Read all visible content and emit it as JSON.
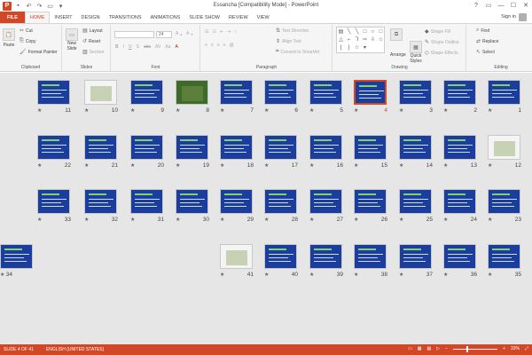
{
  "titlebar": {
    "app_icon": "P",
    "title": "Essancha [Compatibility Mode] - PowerPoint",
    "qat_icons": [
      "save-icon",
      "undo-icon",
      "redo-icon",
      "start-from-beginning-icon",
      "customize-icon"
    ],
    "qat_glyphs": [
      "▪",
      "↶",
      "↷",
      "▭",
      "▾"
    ],
    "window_controls": [
      "?",
      "▭",
      "—",
      "☐",
      "✕"
    ]
  },
  "tabs": {
    "items": [
      "FILE",
      "HOME",
      "INSERT",
      "DESIGN",
      "TRANSITIONS",
      "ANIMATIONS",
      "SLIDE SHOW",
      "REVIEW",
      "VIEW"
    ],
    "active": "HOME",
    "signin": "Sign in"
  },
  "ribbon": {
    "clipboard": {
      "label": "Clipboard",
      "paste": "Paste",
      "cut": "Cut",
      "copy": "Copy",
      "format_painter": "Format Painter"
    },
    "slides": {
      "label": "Slides",
      "new_slide": "New",
      "new_slide_2": "Slide",
      "layout": "Layout",
      "reset": "Reset",
      "section": "Section"
    },
    "font": {
      "label": "Font",
      "font_size": "24"
    },
    "paragraph": {
      "label": "Paragraph",
      "text_direction": "Text Direction",
      "align_text": "Align Text",
      "convert_smartart": "Convert to SmartArt"
    },
    "drawing": {
      "label": "Drawing",
      "arrange": "Arrange",
      "quick_styles": "Quick",
      "quick_styles_2": "Styles",
      "shape_fill": "Shape Fill",
      "shape_outline": "Shape Outline",
      "shape_effects": "Shape Effects"
    },
    "editing": {
      "label": "Editing",
      "find": "Find",
      "replace": "Replace",
      "select": "Select"
    }
  },
  "slides": [
    {
      "n": "11",
      "kind": "blue"
    },
    {
      "n": "10",
      "kind": "white"
    },
    {
      "n": "9",
      "kind": "blue"
    },
    {
      "n": "8",
      "kind": "photo"
    },
    {
      "n": "7",
      "kind": "blue"
    },
    {
      "n": "6",
      "kind": "blue"
    },
    {
      "n": "5",
      "kind": "blue"
    },
    {
      "n": "4",
      "kind": "blue"
    },
    {
      "n": "3",
      "kind": "blue"
    },
    {
      "n": "2",
      "kind": "blue"
    },
    {
      "n": "1",
      "kind": "blue"
    },
    {
      "n": "22",
      "kind": "blue"
    },
    {
      "n": "21",
      "kind": "blue"
    },
    {
      "n": "20",
      "kind": "blue"
    },
    {
      "n": "19",
      "kind": "blue"
    },
    {
      "n": "18",
      "kind": "blue"
    },
    {
      "n": "17",
      "kind": "blue"
    },
    {
      "n": "16",
      "kind": "blue"
    },
    {
      "n": "15",
      "kind": "blue"
    },
    {
      "n": "14",
      "kind": "blue"
    },
    {
      "n": "13",
      "kind": "blue"
    },
    {
      "n": "12",
      "kind": "white"
    },
    {
      "n": "33",
      "kind": "blue"
    },
    {
      "n": "32",
      "kind": "blue"
    },
    {
      "n": "31",
      "kind": "blue"
    },
    {
      "n": "30",
      "kind": "blue"
    },
    {
      "n": "29",
      "kind": "blue"
    },
    {
      "n": "28",
      "kind": "blue"
    },
    {
      "n": "27",
      "kind": "blue"
    },
    {
      "n": "26",
      "kind": "blue"
    },
    {
      "n": "25",
      "kind": "blue"
    },
    {
      "n": "24",
      "kind": "blue"
    },
    {
      "n": "23",
      "kind": "blue"
    },
    {
      "n": "41",
      "kind": "white"
    },
    {
      "n": "40",
      "kind": "blue"
    },
    {
      "n": "39",
      "kind": "blue"
    },
    {
      "n": "38",
      "kind": "blue"
    },
    {
      "n": "37",
      "kind": "blue"
    },
    {
      "n": "36",
      "kind": "blue"
    },
    {
      "n": "35",
      "kind": "blue"
    },
    {
      "n": "34",
      "kind": "blue"
    }
  ],
  "selected_slide": "4",
  "statusbar": {
    "slide_info": "SLIDE 4 OF 41",
    "language": "ENGLISH (UNITED STATES)",
    "zoom": "33%"
  },
  "colors": {
    "accent": "#d24726",
    "slide_bg": "#1a3d9e",
    "sorter_bg": "#e6e6e6"
  }
}
